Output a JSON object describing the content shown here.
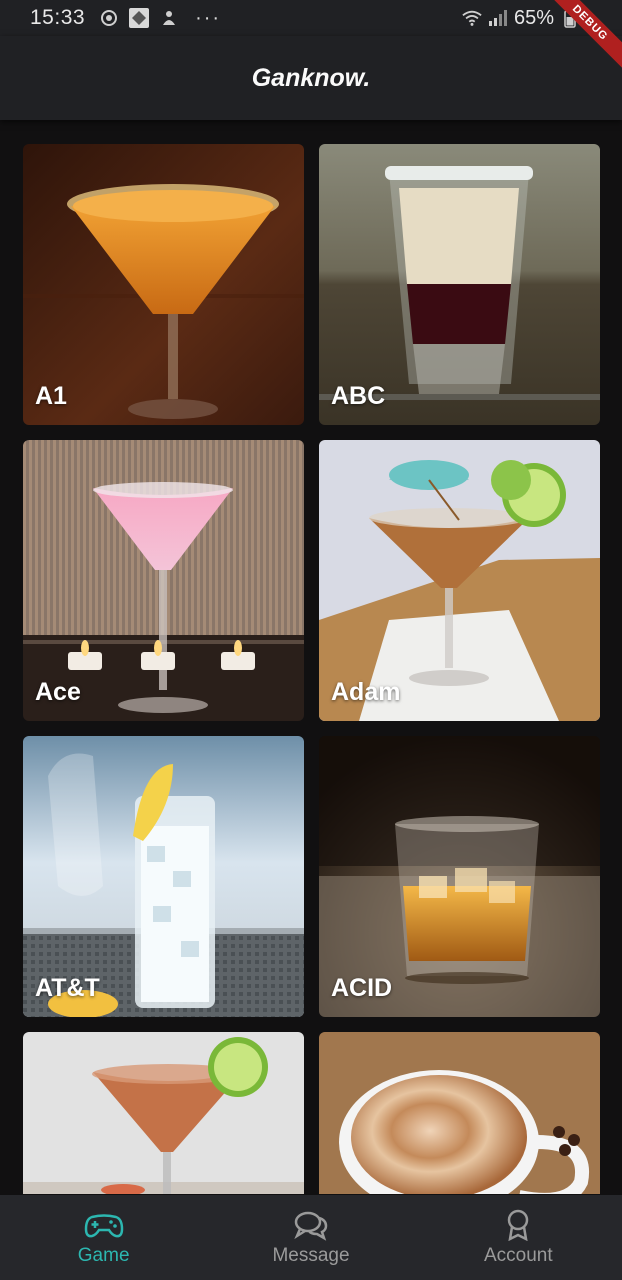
{
  "status_bar": {
    "time": "15:33",
    "battery": "65%",
    "icons": [
      "sync-icon",
      "app-icon",
      "notification-icon",
      "more-icon",
      "wifi-icon",
      "signal-icon",
      "battery-icon"
    ]
  },
  "debug_banner": "DEBUG",
  "app_bar": {
    "title": "Ganknow."
  },
  "drinks": [
    {
      "name": "A1"
    },
    {
      "name": "ABC"
    },
    {
      "name": "Ace"
    },
    {
      "name": "Adam"
    },
    {
      "name": "AT&T"
    },
    {
      "name": "ACID"
    },
    {
      "name": ""
    },
    {
      "name": ""
    }
  ],
  "bottom_nav": {
    "items": [
      {
        "label": "Game",
        "icon": "gamepad-icon",
        "active": true
      },
      {
        "label": "Message",
        "icon": "chat-icon",
        "active": false
      },
      {
        "label": "Account",
        "icon": "award-icon",
        "active": false
      }
    ]
  },
  "colors": {
    "accent": "#2cb7b0",
    "app_bar": "#202124",
    "background": "#111011",
    "nav_background": "#26272b"
  }
}
